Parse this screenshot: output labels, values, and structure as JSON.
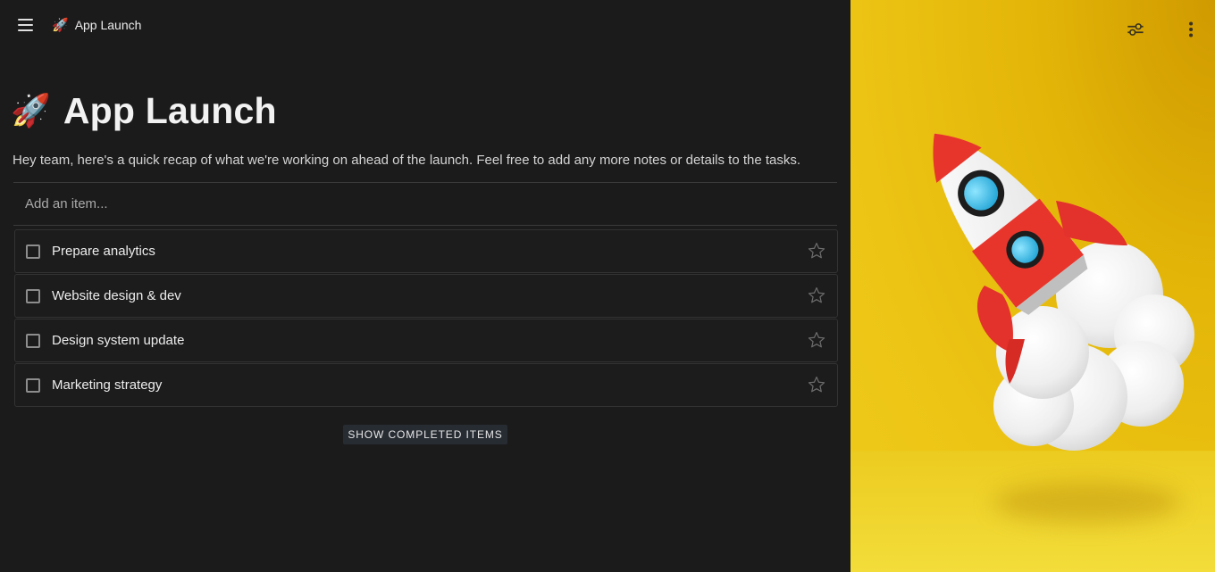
{
  "topbar": {
    "breadcrumb_emoji": "🚀",
    "breadcrumb_label": "App Launch"
  },
  "page": {
    "title_emoji": "🚀",
    "title": "App Launch",
    "description": "Hey team, here's a quick recap of what we're working on ahead of the launch. Feel free to add any more notes or details to the tasks."
  },
  "add_item": {
    "placeholder": "Add an item..."
  },
  "tasks": [
    {
      "label": "Prepare analytics"
    },
    {
      "label": "Website design & dev"
    },
    {
      "label": "Design system update"
    },
    {
      "label": "Marketing strategy"
    }
  ],
  "show_completed_label": "SHOW COMPLETED ITEMS",
  "colors": {
    "background": "#1b1b1b",
    "cover_yellow": "#ecc414",
    "button_bg": "#272c33"
  },
  "icons": [
    "menu-icon",
    "rocket-icon",
    "checkbox-icon",
    "star-icon",
    "sliders-icon",
    "more-vertical-icon"
  ]
}
